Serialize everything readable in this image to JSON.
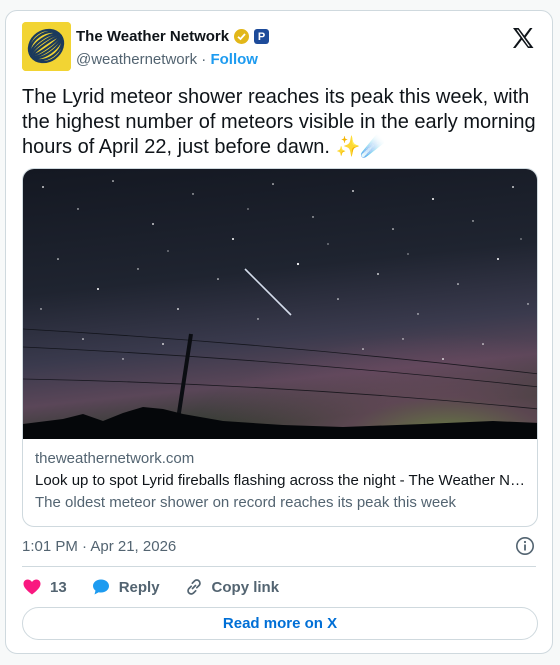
{
  "account": {
    "name": "The Weather Network",
    "handle": "@weathernetwork",
    "separator": "·",
    "follow_label": "Follow",
    "badge_p": "P"
  },
  "tweet": {
    "text": "The Lyrid meteor shower reaches its peak this week, with the highest number of meteors visible in the early morning hours of April 22, just before dawn. ✨☄️"
  },
  "link_card": {
    "domain": "theweathernetwork.com",
    "title": "Look up to spot Lyrid fireballs flashing across the night - The Weather Network",
    "description": "The oldest meteor shower on record reaches its peak this week"
  },
  "meta": {
    "timestamp": "1:01 PM · Apr 21, 2026"
  },
  "actions": {
    "like_count": "13",
    "reply_label": "Reply",
    "copy_label": "Copy link"
  },
  "read_more_label": "Read more on X",
  "colors": {
    "like": "#f91880",
    "reply": "#1d9bf0",
    "follow": "#1d9bf0",
    "avatar_bg": "#f2d433",
    "read_more": "#006fd6"
  }
}
